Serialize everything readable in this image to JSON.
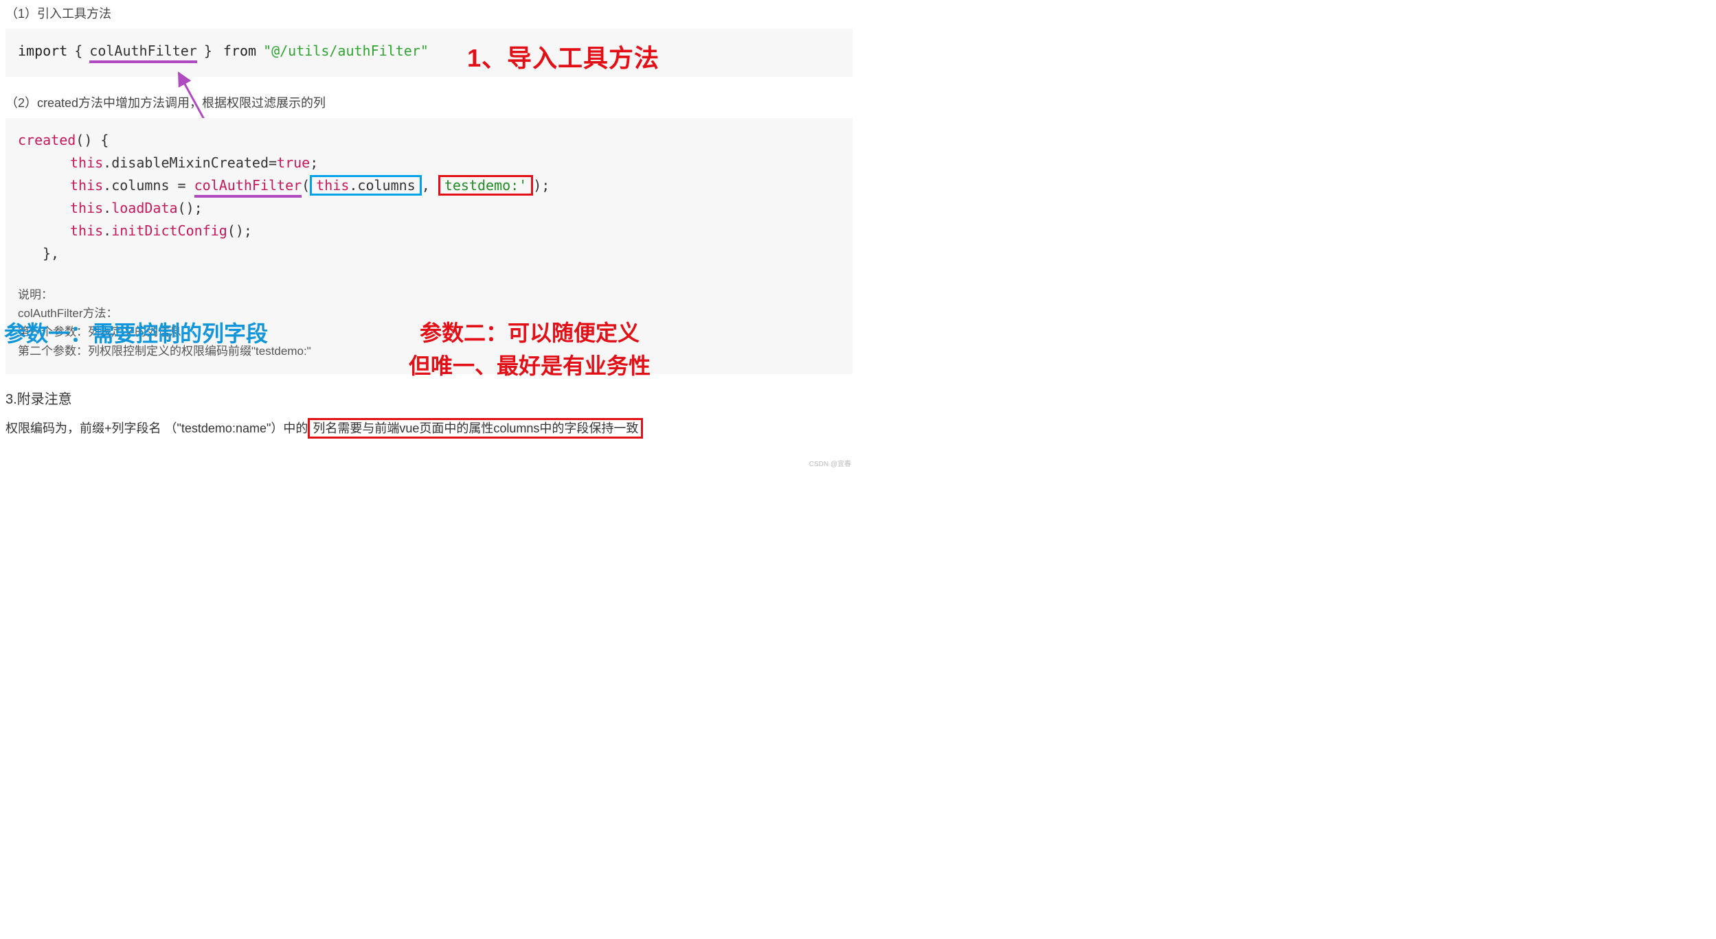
{
  "step1": {
    "title": "（1）引入工具方法",
    "code": {
      "import_kw": "import",
      "brace_open": "{",
      "identifier": "colAuthFilter",
      "brace_close": "}",
      "from_kw": "from",
      "path_str": "\"@/utils/authFilter\""
    }
  },
  "anno1": "1、导入工具方法",
  "step2": {
    "title": "（2）created方法中增加方法调用，根据权限过滤展示的列",
    "code": {
      "created_kw": "created",
      "parens": "() {",
      "line1_pre": "this",
      "line1_mid": ".disableMixinCreated=",
      "line1_val": "true",
      "line1_semi": ";",
      "line2_pre": "this",
      "line2_cols": ".columns = ",
      "line2_fn": "colAuthFilter",
      "line2_lp": "(",
      "line2_this": "this",
      "line2_cols2": ".columns",
      "line2_comma": ",",
      "line2_arg": "testdemo:'",
      "line2_rp": ");",
      "line3_pre": "this",
      "line3_mid": ".",
      "line3_fn": "loadData",
      "line3_end": "();",
      "line4_pre": "this",
      "line4_mid": ".",
      "line4_fn": "initDictConfig",
      "line4_end": "();",
      "close": "},"
    },
    "notes": {
      "l1": "说明：",
      "l2": "colAuthFilter方法：",
      "l3": "第一个参数：列表定义的列信息",
      "l4": "第二个参数：列权限控制定义的权限编码前缀\"testdemo:\""
    }
  },
  "anno_param1": "参数一：需要控制的列字段",
  "anno_param2_line1": "参数二：可以随便定义",
  "anno_param2_line2": "但唯一、最好是有业务性",
  "appendix": {
    "title": "3.附录注意",
    "line_pre": "权限编码为，前缀+列字段名 （\"testdemo:name\"）中的",
    "line_box": "列名需要与前端vue页面中的属性columns中的字段保持一致"
  },
  "watermark": "CSDN @宜春"
}
